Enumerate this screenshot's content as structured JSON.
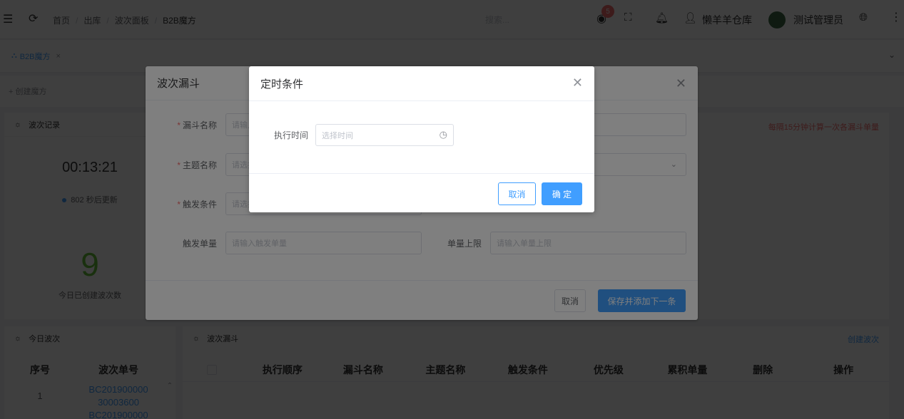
{
  "topbar": {
    "breadcrumbs": [
      "首页",
      "出库",
      "波次面板",
      "B2B魔方"
    ],
    "search_placeholder": "搜索...",
    "notification_count": "5",
    "warehouse": "懒羊羊仓库",
    "user": "测试管理员"
  },
  "tabs": {
    "active_tab": "B2B魔方",
    "close": "×"
  },
  "toolbar": {
    "create_label": "+ 创建魔方"
  },
  "wave_record": {
    "title": "波次记录",
    "timer": "00:13:21",
    "update_text": "802 秒后更新",
    "count": "9",
    "count_label": "今日已创建波次数"
  },
  "funnel_notice": "每隔15分钟计算一次各漏斗单量",
  "today_wave": {
    "title": "今日波次",
    "columns": [
      "序号",
      "波次单号"
    ],
    "rows": [
      {
        "index": "1",
        "wave_no_line1": "BC201900000",
        "wave_no_line2": "30003600",
        "wave_no_line3": "BC201900000"
      }
    ]
  },
  "funnel_panel": {
    "title": "波次漏斗",
    "create_link": "创建波次",
    "columns": [
      "执行顺序",
      "漏斗名称",
      "主题名称",
      "触发条件",
      "优先级",
      "累积单量",
      "删除",
      "操作"
    ]
  },
  "dialog_funnel": {
    "title": "波次漏斗",
    "funnel_name_label": "漏斗名称",
    "funnel_name_placeholder": "请输入",
    "theme_name_label": "主题名称",
    "theme_name_placeholder": "请选择",
    "trigger_label": "触发条件",
    "trigger_placeholder": "请选择",
    "trigger_qty_label": "触发单量",
    "trigger_qty_placeholder": "请输入触发单量",
    "max_qty_label": "单量上限",
    "max_qty_placeholder": "请输入单量上限",
    "cancel": "取消",
    "save_next": "保存并添加下一条"
  },
  "dialog_timer": {
    "title": "定时条件",
    "exec_time_label": "执行时间",
    "exec_time_placeholder": "选择时间",
    "cancel": "取消",
    "confirm": "确 定"
  }
}
